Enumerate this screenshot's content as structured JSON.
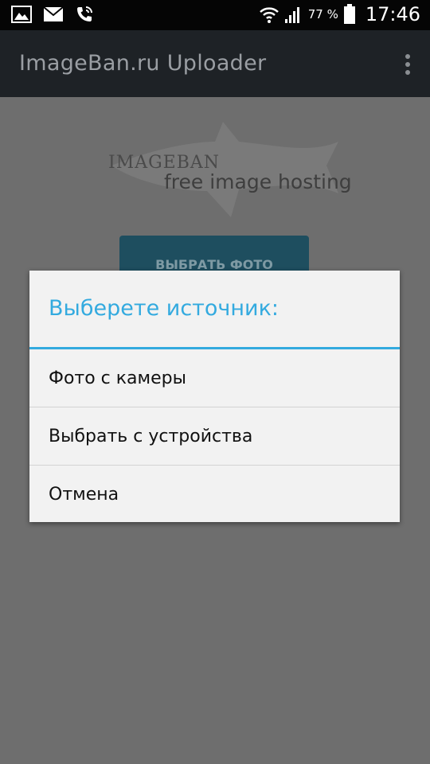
{
  "status_bar": {
    "battery_percent": "77 %",
    "time": "17:46",
    "icons": [
      "picture-icon",
      "mail-icon",
      "phone-icon",
      "wifi-icon",
      "signal-icon",
      "battery-icon"
    ]
  },
  "action_bar": {
    "title": "ImageBan.ru Uploader",
    "overflow_icon": "overflow-menu-icon"
  },
  "background": {
    "logo_top": "IMAGEBAN",
    "logo_bottom": "free image hosting",
    "pick_button": "ВЫБРАТЬ ФОТО"
  },
  "dialog": {
    "title": "Выберете источник:",
    "items": [
      {
        "label": "Фото с камеры"
      },
      {
        "label": "Выбрать с устройства"
      },
      {
        "label": "Отмена"
      }
    ],
    "accent_color": "#33aadf"
  }
}
